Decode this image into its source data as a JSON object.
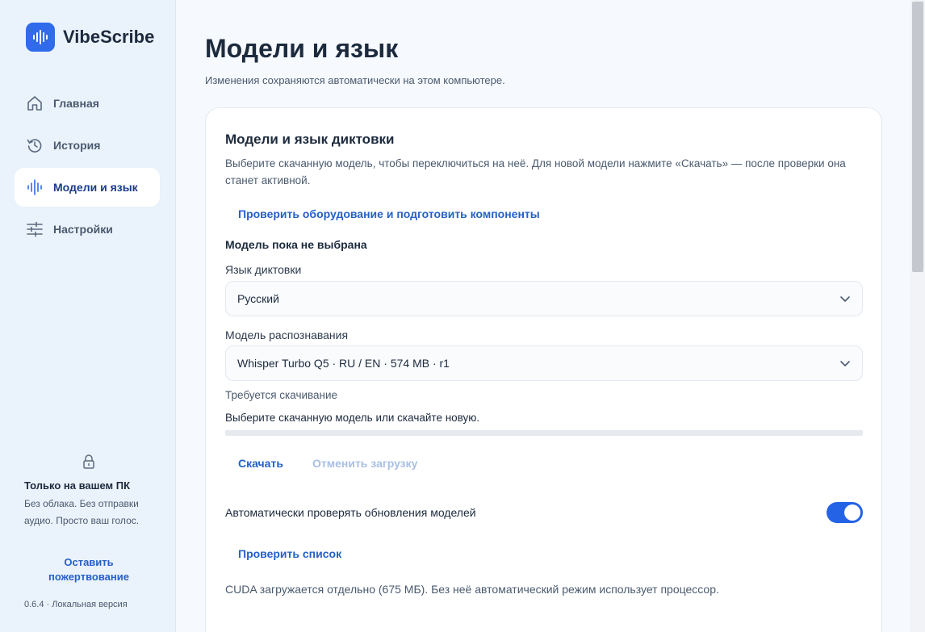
{
  "app": {
    "name": "VibeScribe"
  },
  "sidebar": {
    "items": [
      {
        "label": "Главная",
        "icon": "home-icon",
        "active": false
      },
      {
        "label": "История",
        "icon": "history-icon",
        "active": false
      },
      {
        "label": "Модели и язык",
        "icon": "waveform-icon",
        "active": true
      },
      {
        "label": "Настройки",
        "icon": "sliders-icon",
        "active": false
      }
    ],
    "privacy": {
      "icon": "lock-icon",
      "title": "Только на вашем ПК",
      "text": "Без облака. Без отправки аудио. Просто ваш голос."
    },
    "donate_label": "Оставить пожертвование",
    "version": "0.6.4 · Локальная версия"
  },
  "page": {
    "title": "Модели и язык",
    "subtitle": "Изменения сохраняются автоматически на этом компьютере."
  },
  "card": {
    "title": "Модели и язык диктовки",
    "description": "Выберите скачанную модель, чтобы переключиться на неё. Для новой модели нажмите «Скачать» — после проверки она станет активной.",
    "check_hardware_label": "Проверить оборудование и подготовить компоненты",
    "model_status": "Модель пока не выбрана",
    "language": {
      "label": "Язык диктовки",
      "value": "Русский"
    },
    "model": {
      "label": "Модель распознавания",
      "value": "Whisper Turbo Q5 · RU / EN · 574 MB · r1"
    },
    "download_required": "Требуется скачивание",
    "download_hint": "Выберите скачанную модель или скачайте новую.",
    "download_progress": 0,
    "download_label": "Скачать",
    "cancel_download_label": "Отменить загрузку",
    "auto_update_label": "Автоматически проверять обновления моделей",
    "auto_update_enabled": true,
    "check_list_label": "Проверить список",
    "cuda_note": "CUDA загружается отдельно (675 МБ). Без неё автоматический режим использует процессор."
  },
  "colors": {
    "accent": "#2f6bea",
    "link": "#2560c8",
    "sidebar_bg": "#eaf2fb"
  }
}
